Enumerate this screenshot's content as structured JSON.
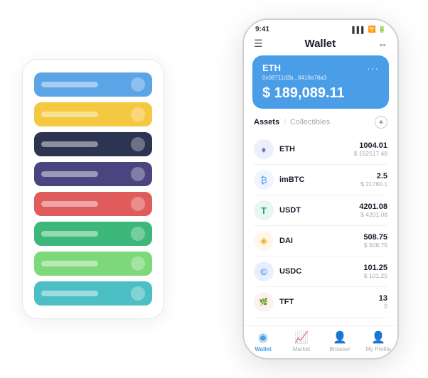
{
  "phone": {
    "status_time": "9:41",
    "title": "Wallet",
    "eth_card": {
      "title": "ETH",
      "address": "0x08711d3b...8418a78a3",
      "balance": "$ 189,089.11",
      "currency_symbol": "$"
    },
    "assets_tab": "Assets",
    "collectibles_tab": "Collectibles",
    "assets": [
      {
        "name": "ETH",
        "amount": "1004.01",
        "usd": "$ 162517.48",
        "icon": "♦"
      },
      {
        "name": "imBTC",
        "amount": "2.5",
        "usd": "$ 21760.1",
        "icon": "₿"
      },
      {
        "name": "USDT",
        "amount": "4201.08",
        "usd": "$ 4201.08",
        "icon": "T"
      },
      {
        "name": "DAI",
        "amount": "508.75",
        "usd": "$ 508.75",
        "icon": "◈"
      },
      {
        "name": "USDC",
        "amount": "101.25",
        "usd": "$ 101.25",
        "icon": "©"
      },
      {
        "name": "TFT",
        "amount": "13",
        "usd": "0",
        "icon": "🌿"
      }
    ],
    "nav": [
      {
        "label": "Wallet",
        "active": true
      },
      {
        "label": "Market",
        "active": false
      },
      {
        "label": "Browser",
        "active": false
      },
      {
        "label": "My Profile",
        "active": false
      }
    ]
  },
  "card_stack": {
    "cards": [
      {
        "color": "blue",
        "css": "card-blue"
      },
      {
        "color": "yellow",
        "css": "card-yellow"
      },
      {
        "color": "dark",
        "css": "card-dark"
      },
      {
        "color": "purple",
        "css": "card-purple"
      },
      {
        "color": "red",
        "css": "card-red"
      },
      {
        "color": "green",
        "css": "card-green"
      },
      {
        "color": "light-green",
        "css": "card-light-green"
      },
      {
        "color": "teal",
        "css": "card-teal"
      }
    ]
  }
}
